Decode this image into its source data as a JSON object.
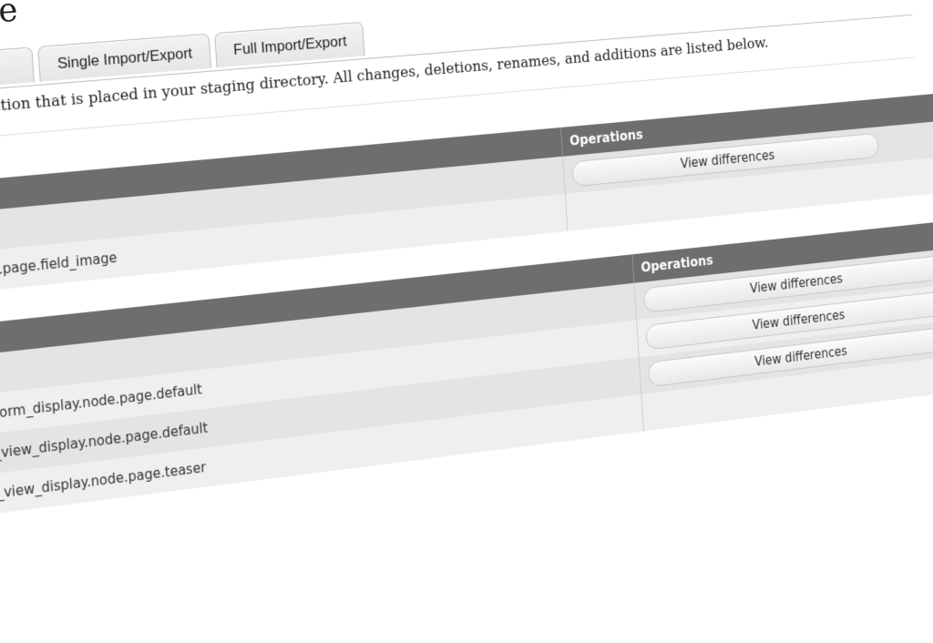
{
  "page": {
    "title": "onize"
  },
  "tabs": [
    {
      "label": ""
    },
    {
      "label": "Single Import/Export"
    },
    {
      "label": "Full Import/Export"
    }
  ],
  "description": "nfiguration that is placed in your staging directory. All changes, deletions, renames, and additions are listed below.",
  "tables": [
    {
      "header": {
        "name": "",
        "operations": "Operations"
      },
      "rows": [
        {
          "name": "",
          "button": "View differences"
        },
        {
          "name": "node.page.field_image",
          "button": ""
        }
      ]
    },
    {
      "header": {
        "name": "",
        "operations": "Operations"
      },
      "rows": [
        {
          "name": "",
          "button": "View differences"
        },
        {
          "name": "ty_form_display.node.page.default",
          "button": "View differences"
        },
        {
          "name": "ity_view_display.node.page.default",
          "button": "View differences"
        },
        {
          "name": "ity_view_display.node.page.teaser",
          "button": ""
        }
      ]
    }
  ]
}
